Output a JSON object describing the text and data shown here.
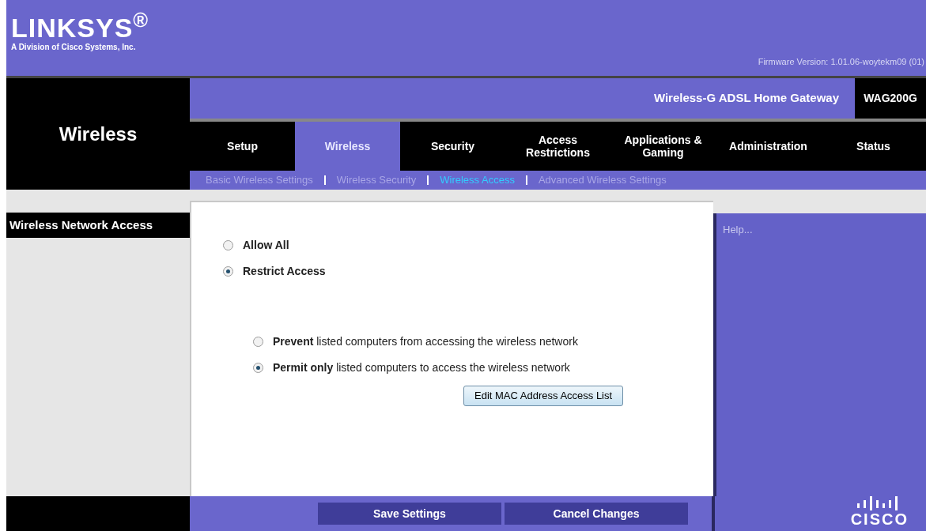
{
  "header": {
    "logo": "LINKSYS$^{®}$",
    "tagline": "A Division of Cisco Systems, Inc.",
    "firmware": "Firmware Version: 1.01.06-woytekm09 (01)"
  },
  "product": {
    "name": "Wireless-G ADSL Home Gateway",
    "model": "WAG200G"
  },
  "section_title": "Wireless",
  "tabs": [
    {
      "label": "Setup",
      "selected": false
    },
    {
      "label": "Wireless",
      "selected": true
    },
    {
      "label": "Security",
      "selected": false
    },
    {
      "label": "Access Restrictions",
      "selected": false
    },
    {
      "label": "Applications & Gaming",
      "selected": false
    },
    {
      "label": "Administration",
      "selected": false
    },
    {
      "label": "Status",
      "selected": false
    }
  ],
  "subtabs": [
    {
      "label": "Basic Wireless Settings",
      "selected": false
    },
    {
      "label": "Wireless Security",
      "selected": false
    },
    {
      "label": "Wireless Access",
      "selected": true
    },
    {
      "label": "Advanced Wireless Settings",
      "selected": false
    }
  ],
  "sidebar": {
    "title": "Wireless Network Access"
  },
  "access_mode": [
    {
      "label": "Allow All",
      "selected": false
    },
    {
      "label": "Restrict Access",
      "selected": true
    }
  ],
  "policy": [
    {
      "label": "**Prevent** listed computers from accessing the wireless network",
      "selected": false
    },
    {
      "label": "**Permit only** listed computers to access the wireless network",
      "selected": true
    }
  ],
  "edit_button": "Edit MAC Address Access List",
  "help": {
    "text": "Help..."
  },
  "footer_buttons": [
    "Save Settings",
    "Cancel Changes"
  ],
  "brand": {
    "logo": "CISCO"
  }
}
